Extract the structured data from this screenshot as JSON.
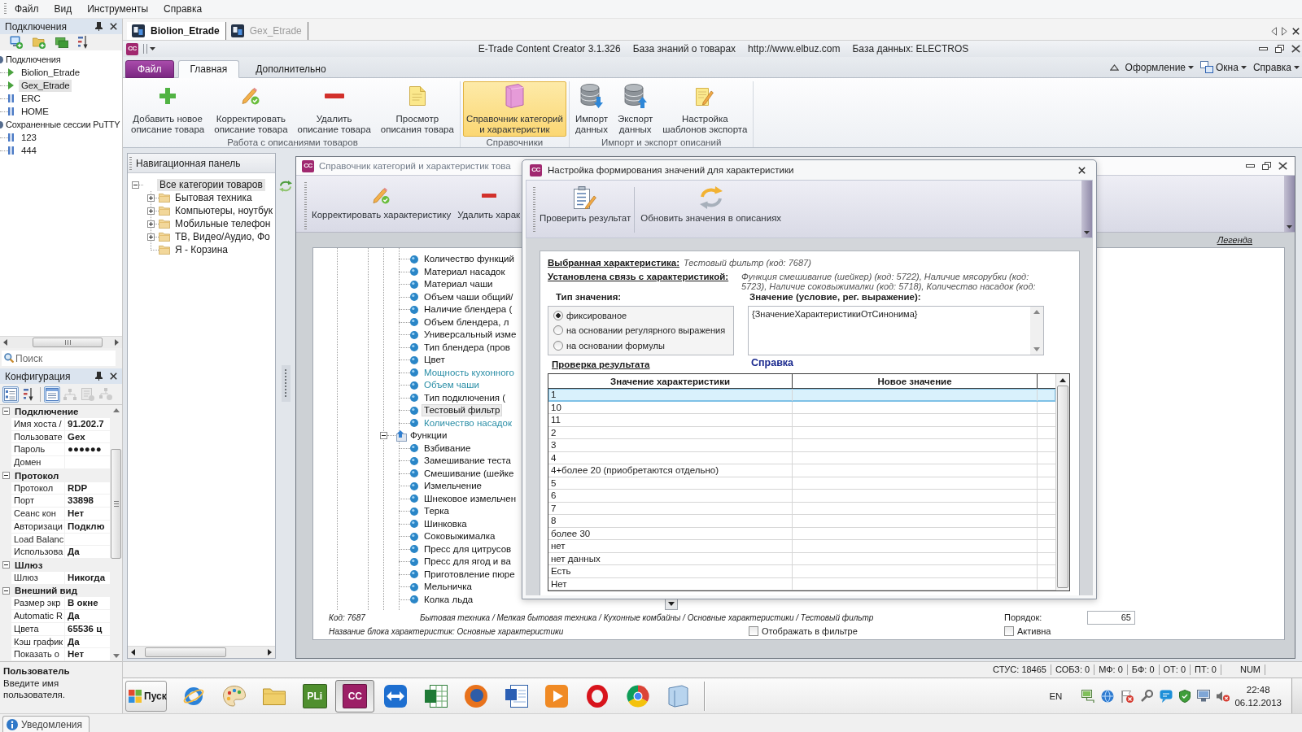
{
  "menu_bar": {
    "items": [
      "Файл",
      "Вид",
      "Инструменты",
      "Справка"
    ]
  },
  "connections_panel": {
    "title": "Подключения",
    "tree": [
      {
        "label": "Подключения",
        "kind": "root",
        "selected": false,
        "children": [
          {
            "label": "Biolion_Etrade",
            "kind": "connection",
            "connected": true,
            "selected": false
          },
          {
            "label": "Gex_Etrade",
            "kind": "connection",
            "connected": true,
            "selected": true
          },
          {
            "label": "ERC",
            "kind": "connection",
            "connected": false,
            "selected": false
          },
          {
            "label": "HOME",
            "kind": "connection",
            "connected": false,
            "selected": false
          }
        ]
      },
      {
        "label": "Сохраненные сессии PuTTY",
        "kind": "root",
        "selected": false,
        "children": [
          {
            "label": "123",
            "kind": "connection",
            "connected": false,
            "selected": false
          },
          {
            "label": "444",
            "kind": "connection",
            "connected": false,
            "selected": false
          }
        ]
      }
    ],
    "search": {
      "placeholder": "Поиск"
    }
  },
  "config_panel": {
    "title": "Конфигурация",
    "toolbar": [
      {
        "selected": true,
        "disabled": false
      },
      {
        "selected": false,
        "disabled": false
      },
      {
        "selected": true,
        "disabled": false
      },
      {
        "selected": false,
        "disabled": true
      },
      {
        "selected": false,
        "disabled": true
      },
      {
        "selected": false,
        "disabled": true
      }
    ],
    "categories": [
      {
        "label": "Подключение",
        "expanded": true,
        "properties": [
          {
            "name": "Имя хоста /",
            "value": "91.202.7"
          },
          {
            "name": "Пользовате",
            "value": "Gex"
          },
          {
            "name": "Пароль",
            "value": "●●●●●●"
          },
          {
            "name": "Домен"
          }
        ]
      },
      {
        "label": "Протокол",
        "expanded": true,
        "properties": [
          {
            "name": "Протокол",
            "value": "RDP"
          },
          {
            "name": "Порт",
            "value": "33898"
          },
          {
            "name": "Сеанс кон",
            "value": "Нет"
          },
          {
            "name": "Авторизаци",
            "value": "Подклю"
          },
          {
            "name": "Load Balanc"
          },
          {
            "name": "Использова",
            "value": "Да"
          }
        ]
      },
      {
        "label": "Шлюз",
        "expanded": true,
        "properties": [
          {
            "name": "Шлюз",
            "value": "Никогда"
          }
        ]
      },
      {
        "label": "Внешний вид",
        "expanded": true,
        "properties": [
          {
            "name": "Размер экр",
            "value": "В окне"
          },
          {
            "name": "Automatic R",
            "value": "Да"
          },
          {
            "name": "Цвета",
            "value": "65536 ц"
          },
          {
            "name": "Кэш график",
            "value": "Да"
          },
          {
            "name": "Показать о",
            "value": "Нет"
          }
        ]
      }
    ],
    "description": {
      "title": "Пользователь",
      "text": "Введите имя пользователя."
    }
  },
  "remote_tabs": [
    {
      "label": "Biolion_Etrade",
      "selected": true
    },
    {
      "label": "Gex_Etrade",
      "selected": false
    }
  ],
  "app_window": {
    "badge": "CC",
    "title_parts": [
      "E-Trade Content Creator 3.1.326",
      "База знаний о товарах",
      "http://www.elbuz.com",
      "База данных: ELECTROS"
    ]
  },
  "ribbon": {
    "tabs": [
      {
        "label": "Файл",
        "kind": "backstage",
        "selected": false
      },
      {
        "label": "Главная",
        "kind": "tab",
        "selected": true
      },
      {
        "label": "Дополнительно",
        "kind": "tab",
        "selected": false
      }
    ],
    "menus": [
      "Оформление",
      "Окна",
      "Справка"
    ],
    "groups": [
      {
        "label": "Работа с описаниями товаров",
        "buttons": [
          {
            "label": "Добавить новое\nописание товара",
            "selected": false
          },
          {
            "label": "Корректировать\nописание товара",
            "selected": false
          },
          {
            "label": "Удалить\nописание товара",
            "selected": false
          },
          {
            "label": "Просмотр\nописания товара",
            "selected": false
          }
        ]
      },
      {
        "label": "Справочники",
        "buttons": [
          {
            "label": "Справочник категорий\nи характеристик",
            "selected": true
          }
        ]
      },
      {
        "label": "Импорт и экспорт описаний",
        "buttons": [
          {
            "label": "Импорт\nданных",
            "selected": false
          },
          {
            "label": "Экспорт\nданных",
            "selected": false
          },
          {
            "label": "Настройка\nшаблонов экспорта",
            "selected": false
          }
        ]
      }
    ]
  },
  "nav_panel": {
    "title": "Навигационная панель",
    "tree": [
      {
        "label": "Все категории товаров",
        "expanded": true,
        "selected": true,
        "children": [
          {
            "label": "Бытовая техника",
            "expanded": false,
            "selected": false
          },
          {
            "label": "Компьютеры, ноутбук",
            "expanded": false,
            "selected": false
          },
          {
            "label": "Мобильные телефон",
            "expanded": false,
            "selected": false
          },
          {
            "label": "ТВ, Видео/Аудио, Фо",
            "expanded": false,
            "selected": false
          },
          {
            "label": "Я - Корзина",
            "selected": false
          }
        ]
      }
    ]
  },
  "reference_window": {
    "badge": "CC",
    "title": "Справочник категорий и характеристик това",
    "toolbar": [
      "Корректировать характеристику",
      "Удалить харак"
    ],
    "legend_link": "Легенда",
    "tree": [
      {
        "items": [
          {
            "label": "Количество функций",
            "highlighted": false,
            "selected": false
          },
          {
            "label": "Материал насадок",
            "highlighted": false,
            "selected": false
          },
          {
            "label": "Материал чаши",
            "highlighted": false,
            "selected": false
          },
          {
            "label": "Объем чаши общий/",
            "highlighted": false,
            "selected": false
          },
          {
            "label": "Наличие блендера (",
            "highlighted": false,
            "selected": false
          },
          {
            "label": "Объем блендера, л",
            "highlighted": false,
            "selected": false
          },
          {
            "label": "Универсальный изме",
            "highlighted": false,
            "selected": false
          },
          {
            "label": "Тип блендера (пров",
            "highlighted": false,
            "selected": false
          },
          {
            "label": "Цвет",
            "highlighted": false,
            "selected": false
          },
          {
            "label": "Мощность кухонного",
            "highlighted": true,
            "selected": false
          },
          {
            "label": "Объем чаши",
            "highlighted": true,
            "selected": false
          },
          {
            "label": "Тип подключения (",
            "highlighted": false,
            "selected": false
          },
          {
            "label": "Тестовый фильтр",
            "highlighted": false,
            "selected": true
          },
          {
            "label": "Количество насадок",
            "highlighted": true,
            "selected": false
          }
        ]
      },
      {
        "label": "Функции",
        "expanded": true,
        "items": [
          {
            "label": "Взбивание",
            "highlighted": false,
            "selected": false
          },
          {
            "label": "Замешивание теста",
            "highlighted": false,
            "selected": false
          },
          {
            "label": "Смешивание (шейке",
            "highlighted": false,
            "selected": false
          },
          {
            "label": "Измельчение",
            "highlighted": false,
            "selected": false
          },
          {
            "label": "Шнековое измельчен",
            "highlighted": false,
            "selected": false
          },
          {
            "label": "Терка",
            "highlighted": false,
            "selected": false
          },
          {
            "label": "Шинковка",
            "highlighted": false,
            "selected": false
          },
          {
            "label": "Соковыжималка",
            "highlighted": false,
            "selected": false
          },
          {
            "label": "Пресс для цитрусов",
            "highlighted": false,
            "selected": false
          },
          {
            "label": "Пресс для ягод и ва",
            "highlighted": false,
            "selected": false
          },
          {
            "label": "Приготовление пюре",
            "highlighted": false,
            "selected": false
          },
          {
            "label": "Мельничка",
            "highlighted": false,
            "selected": false
          },
          {
            "label": "Колка льда",
            "highlighted": false,
            "selected": false
          }
        ]
      }
    ],
    "footer": {
      "code": "Код: 7687",
      "path": "Бытовая техника / Мелкая бытовая техника / Кухонные комбайны / Основные характеристики / Тестовый фильтр",
      "block_name": "Название блока характеристик: Основные характеристики",
      "order": {
        "label": "Порядок:",
        "value": "65"
      },
      "checkboxes": [
        {
          "label": "Отображать в фильтре",
          "checked": false
        },
        {
          "label": "Активна",
          "checked": false
        }
      ]
    }
  },
  "dialog": {
    "badge": "CC",
    "title": "Настройка формирования значений для характеристики",
    "toolbar": [
      "Проверить результат",
      "Обновить значения в описаниях"
    ],
    "selected_characteristic": {
      "label": "Выбранная характеристика:",
      "value": "Тестовый фильтр (код: 7687)"
    },
    "linked_characteristics": {
      "label": "Установлена связь с характеристикой:",
      "value": "Функция смешивание (шейкер) (код: 5722), Наличие мясорубки (код: 5723), Наличие соковыжималки (код: 5718), Количество насадок (код:"
    },
    "value_type": {
      "label": "Тип значения:",
      "options": [
        {
          "label": "фиксированое",
          "selected": true
        },
        {
          "label": "на основании регулярного выражения",
          "selected": false
        },
        {
          "label": "на основании формулы",
          "selected": false
        }
      ]
    },
    "value_field": {
      "label": "Значение (условие, рег. выражение):",
      "value": "{ЗначениеХарактеристикиОтСинонима}"
    },
    "help_link": "Справка",
    "check_title": "Проверка результата",
    "table": {
      "columns": [
        "Значение характеристики",
        "Новое значение"
      ],
      "rows": [
        {
          "value": "1",
          "selected": true
        },
        {
          "value": "10",
          "selected": false
        },
        {
          "value": "11",
          "selected": false
        },
        {
          "value": "2",
          "selected": false
        },
        {
          "value": "3",
          "selected": false
        },
        {
          "value": "4",
          "selected": false
        },
        {
          "value": "4+более 20 (приобретаются отдельно)",
          "selected": false
        },
        {
          "value": "5",
          "selected": false
        },
        {
          "value": "6",
          "selected": false
        },
        {
          "value": "7",
          "selected": false
        },
        {
          "value": "8",
          "selected": false
        },
        {
          "value": "более 30",
          "selected": false
        },
        {
          "value": "нет",
          "selected": false
        },
        {
          "value": "нет данных",
          "selected": false
        },
        {
          "value": "Есть",
          "selected": false
        },
        {
          "value": "Нет",
          "selected": false
        }
      ]
    }
  },
  "status_bar": {
    "items": [
      "СТУС: 18465",
      "СОБЗ: 0",
      "МФ: 0",
      "БФ: 0",
      "ОТ: 0",
      "ПТ: 0",
      "NUM"
    ]
  },
  "taskbar": {
    "start": "Пуск",
    "apps": [
      {
        "selected": false
      },
      {
        "selected": false
      },
      {
        "selected": false
      },
      {
        "label": "PLi",
        "selected": false
      },
      {
        "label": "CC",
        "selected": true
      },
      {
        "selected": false
      },
      {
        "selected": false
      },
      {
        "selected": false
      },
      {
        "selected": false
      },
      {
        "selected": false
      },
      {
        "selected": false
      },
      {
        "selected": false
      },
      {
        "selected": false
      }
    ],
    "language": "EN",
    "time": "22:48",
    "date": "06.12.2013"
  },
  "notifications_tab": "Уведомления"
}
